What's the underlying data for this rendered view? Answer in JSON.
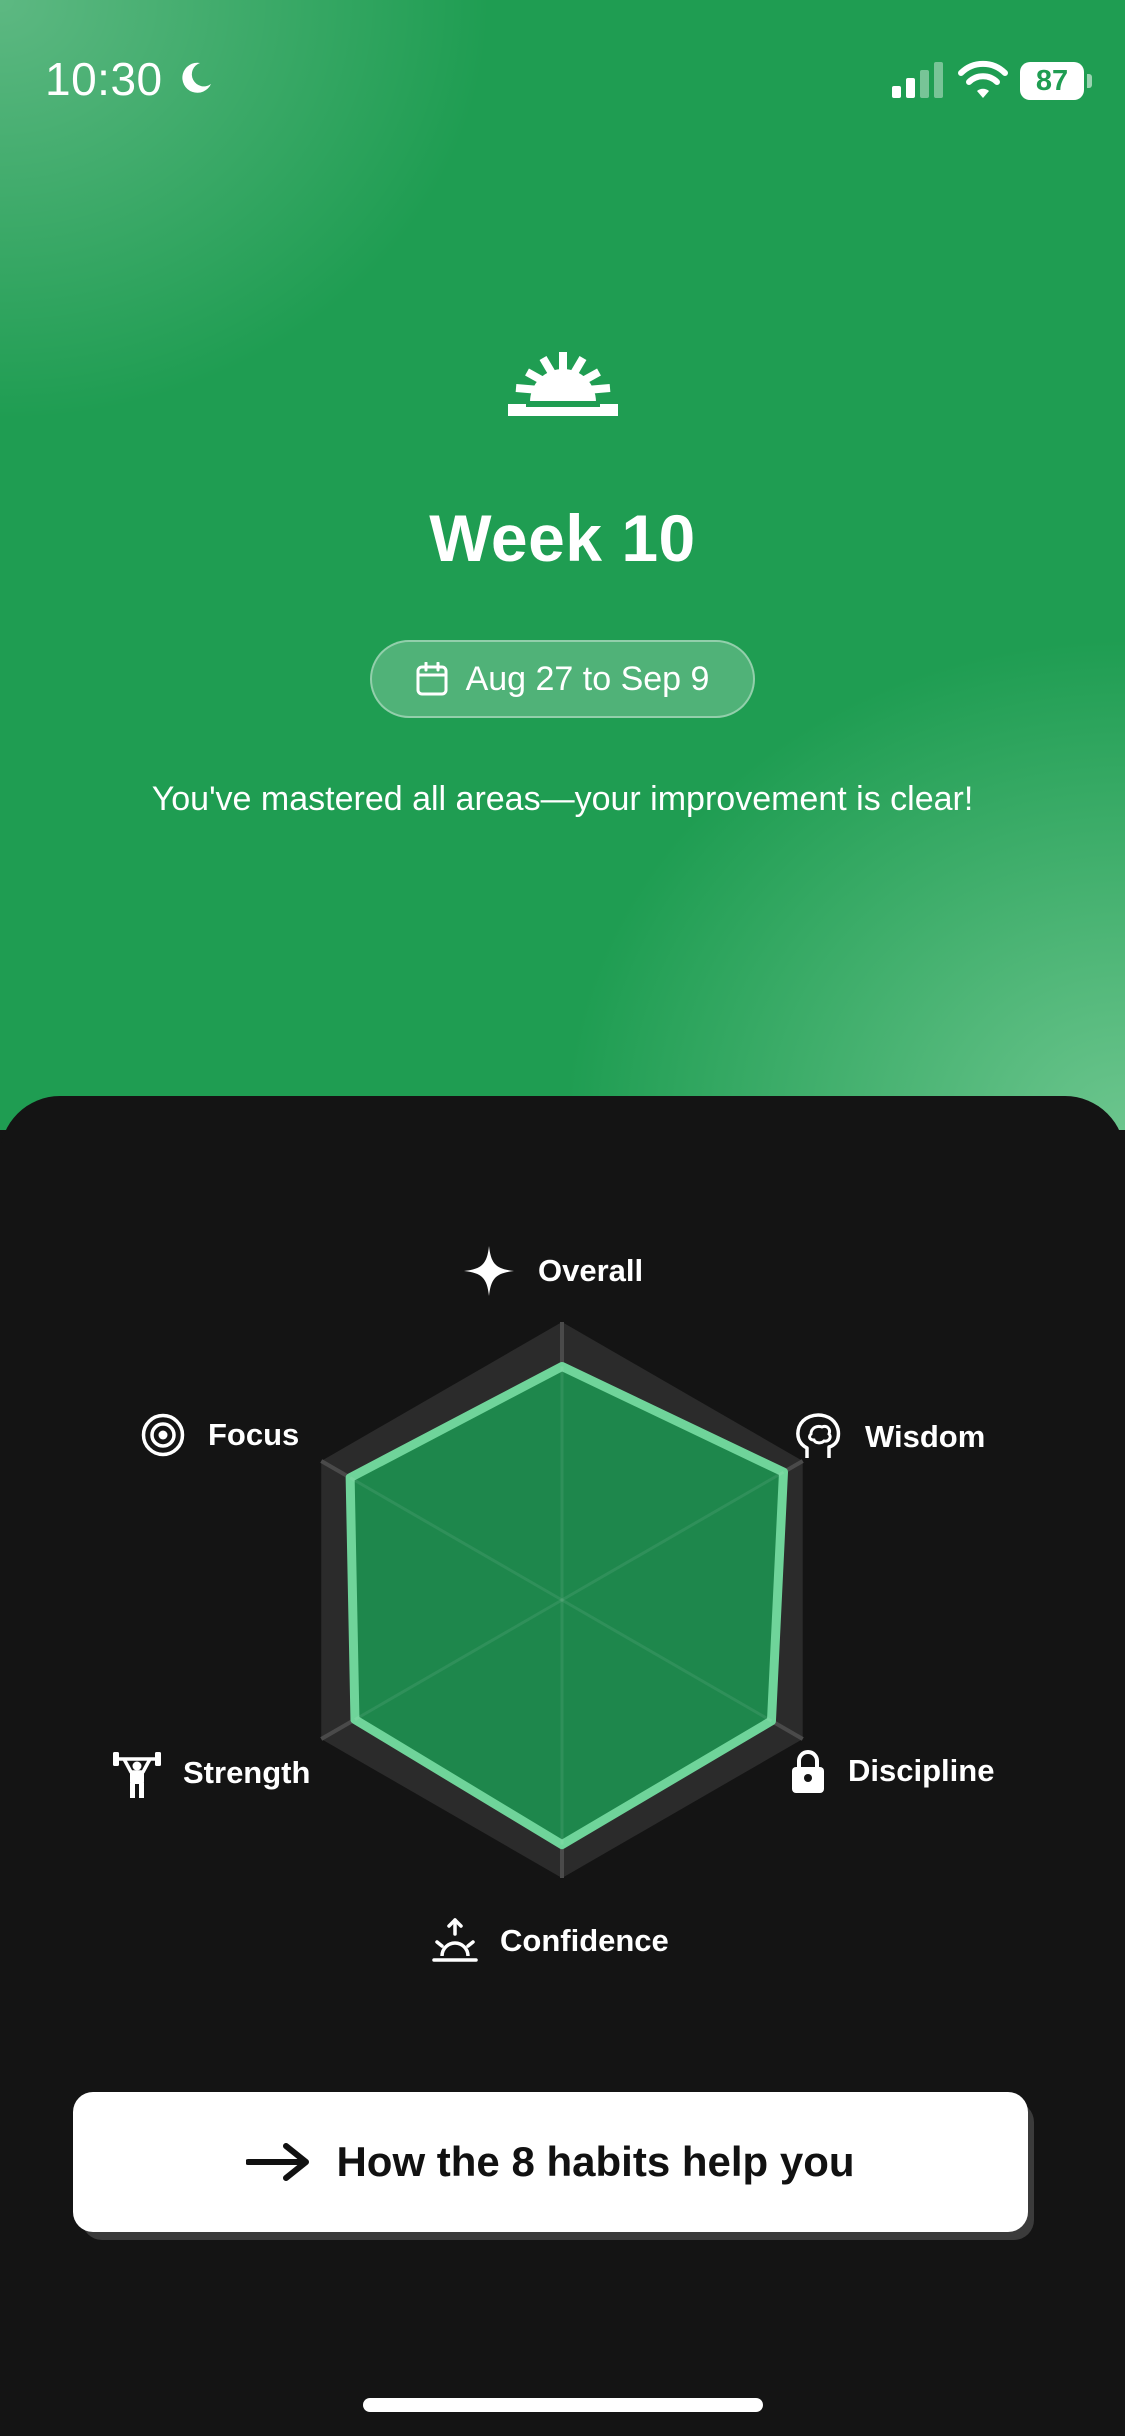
{
  "status_bar": {
    "time": "10:30",
    "battery_level": "87",
    "icons": [
      "moon-icon",
      "signal-icon",
      "wifi-icon",
      "battery-icon"
    ]
  },
  "header": {
    "logo_icon": "sun-rising-icon",
    "title": "Week 10",
    "date_range": "Aug 27 to Sep 9",
    "subtitle": "You've mastered all areas—your improvement is clear!"
  },
  "radar": {
    "axes": [
      {
        "label": "Overall",
        "icon": "sparkle-icon",
        "value": 0.84
      },
      {
        "label": "Wisdom",
        "icon": "brain-head-icon",
        "value": 0.92
      },
      {
        "label": "Discipline",
        "icon": "lock-icon",
        "value": 0.87
      },
      {
        "label": "Confidence",
        "icon": "sunrise-icon",
        "value": 0.88
      },
      {
        "label": "Strength",
        "icon": "weightlifter-icon",
        "value": 0.86
      },
      {
        "label": "Focus",
        "icon": "target-icon",
        "value": 0.88
      }
    ],
    "colors": {
      "grid": "#2b2b2b",
      "spokes": "#4a4a4a",
      "fill": "#1e874c",
      "stroke": "#6fd49a"
    }
  },
  "cta": {
    "label": "How the 8 habits help you",
    "icon": "arrow-right-icon"
  },
  "colors": {
    "hero_green": "#1f9d52",
    "sheet_background": "#141414"
  }
}
